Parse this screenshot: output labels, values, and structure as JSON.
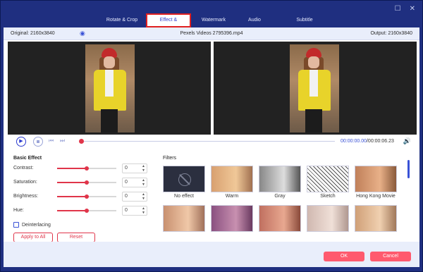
{
  "window": {
    "controls": {
      "minimize": "☐",
      "close": "✕"
    }
  },
  "tabs": [
    {
      "label": "Rotate & Crop"
    },
    {
      "label": "Effect & Filter",
      "active": true
    },
    {
      "label": "Watermark"
    },
    {
      "label": "Audio"
    },
    {
      "label": "Subtitle"
    }
  ],
  "infobar": {
    "original": "Original: 2160x3840",
    "filename": "Pexels Videos 2795396.mp4",
    "output": "Output: 2160x3840"
  },
  "player": {
    "current_time": "00:00:00.00",
    "total_time": "/00:00:06.23",
    "progress": 0.0
  },
  "basic_effect": {
    "title": "Basic Effect",
    "adjustments": [
      {
        "label": "Contrast:",
        "value": "0",
        "level": 0.5
      },
      {
        "label": "Saturation:",
        "value": "0",
        "level": 0.5
      },
      {
        "label": "Brightness:",
        "value": "0",
        "level": 0.5
      },
      {
        "label": "Hue:",
        "value": "0",
        "level": 0.5
      }
    ],
    "deinterlacing_label": "Deinterlacing",
    "deinterlacing_checked": false,
    "apply_all_label": "Apply to All",
    "reset_label": "Reset"
  },
  "filters": {
    "title": "Filters",
    "items": [
      {
        "label": "No effect",
        "style": "none"
      },
      {
        "label": "Warm",
        "style": "warm"
      },
      {
        "label": "Gray",
        "style": "gray"
      },
      {
        "label": "Sketch",
        "style": "sketch"
      },
      {
        "label": "Hong Kong Movie",
        "style": "hk"
      },
      {
        "label": "",
        "style": "warm2"
      },
      {
        "label": "",
        "style": "purple"
      },
      {
        "label": "",
        "style": "warm3"
      },
      {
        "label": "",
        "style": "pale"
      },
      {
        "label": "",
        "style": "warm4"
      }
    ]
  },
  "footer": {
    "ok_label": "OK",
    "cancel_label": "Cancel"
  },
  "colors": {
    "accent_red": "#e0354a",
    "accent_blue": "#2c3bd0",
    "button_red": "#ff5a6e"
  }
}
